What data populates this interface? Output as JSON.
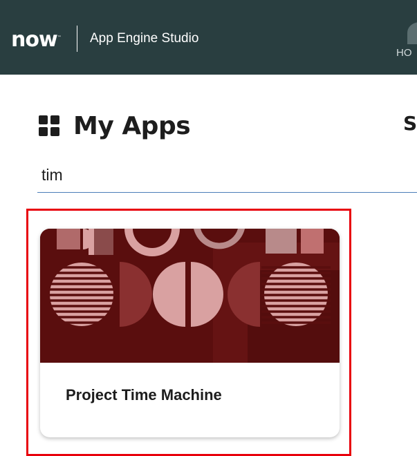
{
  "header": {
    "logo_text": "now",
    "logo_mark": "™",
    "app_title": "App Engine Studio",
    "home_label": "HO"
  },
  "main": {
    "heading": "My Apps",
    "side_heading": "SC",
    "search": {
      "value": "tim"
    }
  },
  "cards": [
    {
      "name": "Project Time Machine"
    }
  ],
  "colors": {
    "header_bg": "#293e40",
    "banner_bg": "#5a0e0e",
    "highlight": "#e8000b",
    "search_underline": "#4a7db8"
  }
}
